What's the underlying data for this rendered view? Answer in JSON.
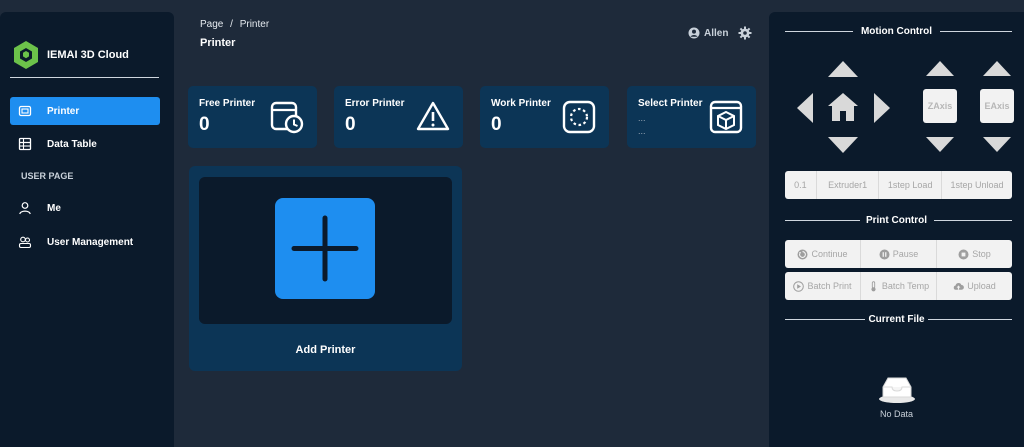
{
  "app": {
    "name": "IEMAI 3D Cloud"
  },
  "sidebar": {
    "items": [
      {
        "label": "Printer",
        "icon": "printer-icon",
        "active": true
      },
      {
        "label": "Data Table",
        "icon": "table-icon",
        "active": false
      },
      {
        "label": "Me",
        "icon": "user-icon",
        "active": false
      },
      {
        "label": "User Management",
        "icon": "users-icon",
        "active": false
      }
    ],
    "section_label": "USER PAGE"
  },
  "header": {
    "breadcrumb": [
      "Page",
      "/",
      "Printer"
    ],
    "title": "Printer",
    "user_name": "Allen"
  },
  "stats": [
    {
      "label": "Free Printer",
      "value": "0",
      "icon": "printer-clock-icon"
    },
    {
      "label": "Error Printer",
      "value": "0",
      "icon": "warning-icon"
    },
    {
      "label": "Work Printer",
      "value": "0",
      "icon": "loading-icon"
    },
    {
      "label": "Select Printer",
      "sub1": "...",
      "sub2": "...",
      "icon": "printer-box-icon"
    }
  ],
  "add_printer": {
    "label": "Add Printer"
  },
  "motion_control": {
    "title": "Motion Control",
    "z_axis": "ZAxis",
    "e_axis": "EAxis",
    "options": [
      "0.1",
      "Extruder1",
      "1step Load",
      "1step Unload"
    ]
  },
  "print_control": {
    "title": "Print Control",
    "row1": [
      "Continue",
      "Pause",
      "Stop"
    ],
    "row2": [
      "Batch Print",
      "Batch Temp",
      "Upload"
    ]
  },
  "current_file": {
    "title": "Current File",
    "empty_text": "No Data"
  },
  "colors": {
    "accent": "#1e8ef0",
    "card": "#0c3556",
    "panel": "#0b1a2b",
    "background": "#1e2a3a"
  }
}
